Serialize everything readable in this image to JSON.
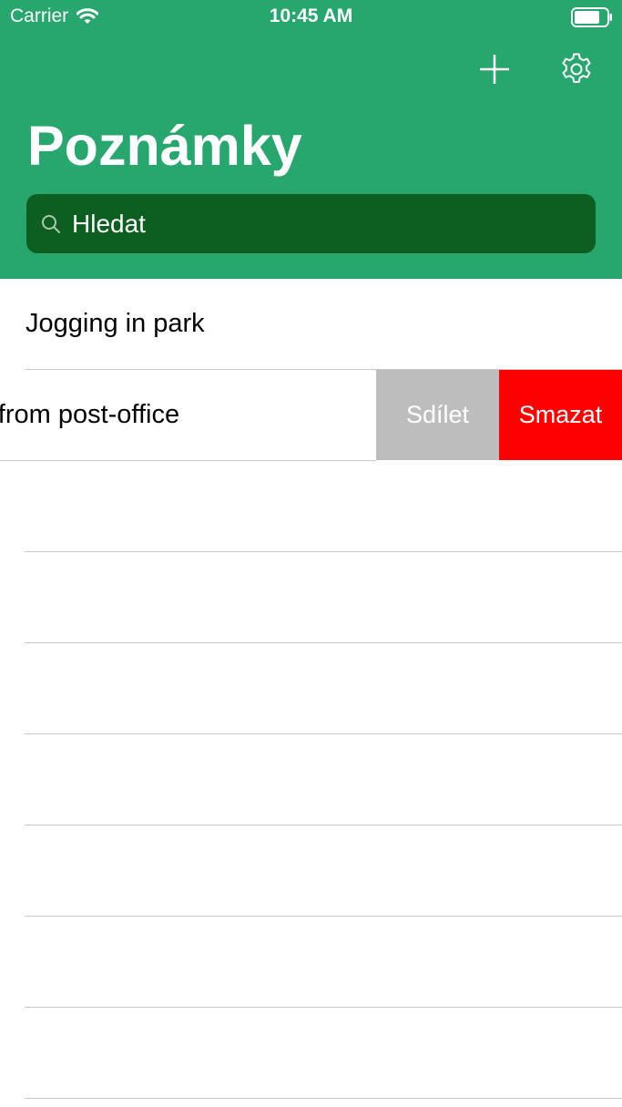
{
  "status_bar": {
    "carrier": "Carrier",
    "time": "10:45 AM",
    "icons": [
      "wifi-icon",
      "battery-icon"
    ]
  },
  "nav": {
    "title": "Poznámky",
    "add_icon": "plus-icon",
    "settings_icon": "gear-icon"
  },
  "search": {
    "placeholder": "Hledat",
    "value": "",
    "icon": "search-icon"
  },
  "notes": [
    {
      "title": "Jogging in park"
    },
    {
      "title": "Pick-up from post-office"
    }
  ],
  "swipe_actions": {
    "share_label": "Sdílet",
    "delete_label": "Smazat"
  },
  "colors": {
    "header": "#27a76d",
    "search_field": "#0d5f21",
    "share_action": "#bdbdbd",
    "delete_action": "#fe0000",
    "separator": "#c8c7cc"
  }
}
